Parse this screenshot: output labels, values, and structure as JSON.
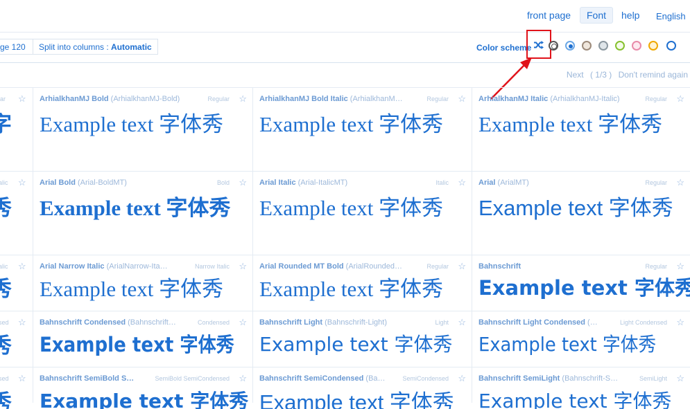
{
  "nav": {
    "front_page": "front page",
    "font": "Font",
    "help": "help",
    "language": "English"
  },
  "toolbar": {
    "page_fragment": "ge 120",
    "split_label": "Split into columns : ",
    "split_value": "Automatic",
    "color_scheme_label": "Color scheme",
    "shuffle_icon": "shuffle-icon",
    "swatches": [
      {
        "ring": "#555555",
        "dot": "#ffffff",
        "bg": "#ffffff"
      },
      {
        "ring": "#6aa7e6",
        "dot": "#1e6fd0",
        "bg": "#ffffff"
      },
      {
        "ring": "#9c8a7a",
        "dot": "#efe6dc",
        "bg": "#efe6dc"
      },
      {
        "ring": "#8b979f",
        "dot": "#dfe5e9",
        "bg": "#dfe5e9"
      },
      {
        "ring": "#86c12e",
        "dot": "#f4fbe9",
        "bg": "#f4fbe9"
      },
      {
        "ring": "#e88aa9",
        "dot": "#fde9f0",
        "bg": "#fde9f0"
      },
      {
        "ring": "#f0a800",
        "dot": "#fff3d2",
        "bg": "#fff3d2"
      },
      {
        "ring": "#1e6fd0",
        "dot": "#1e6fd0",
        "bg": "#ffffff"
      }
    ]
  },
  "pager": {
    "next": "Next",
    "count": "( 1/3 )",
    "dont_remind": "Don't remind again"
  },
  "left_fragments": [
    {
      "tag": "lar",
      "glyph": "字"
    },
    {
      "tag": "alic",
      "glyph": "秀"
    },
    {
      "tag": "alic",
      "glyph": "秀"
    },
    {
      "tag": "sed",
      "glyph": "秀"
    },
    {
      "tag": "sed",
      "glyph": "秀"
    }
  ],
  "sample_text": "Example text 字体秀",
  "rows": [
    [
      {
        "name": "ArhialkhanMJ Bold",
        "ps": " (ArhialkhanMJ-Bold)",
        "tag": "Regular",
        "style": "serif"
      },
      {
        "name": "ArhialkhanMJ Bold Italic",
        "ps": " (ArhialkhanM…",
        "tag": "Regular",
        "style": "serif"
      },
      {
        "name": "ArhialkhanMJ Italic",
        "ps": " (ArhialkhanMJ-Italic)",
        "tag": "Regular",
        "style": "serif"
      }
    ],
    [
      {
        "name": "Arial Bold",
        "ps": " (Arial-BoldMT)",
        "tag": "Bold",
        "style": "serif-bold"
      },
      {
        "name": "Arial Italic",
        "ps": " (Arial-ItalicMT)",
        "tag": "Italic",
        "style": "serif"
      },
      {
        "name": "Arial",
        "ps": " (ArialMT)",
        "tag": "Regular",
        "style": "sans"
      }
    ],
    [
      {
        "name": "Arial Narrow Italic",
        "ps": " (ArialNarrow-Ita…",
        "tag": "Narrow Italic",
        "style": "serif"
      },
      {
        "name": "Arial Rounded MT Bold",
        "ps": " (ArialRounded…",
        "tag": "Regular",
        "style": "serif"
      },
      {
        "name": "Bahnschrift",
        "ps": "",
        "tag": "Regular",
        "style": "sans-semibold"
      }
    ],
    [
      {
        "name": "Bahnschrift Condensed",
        "ps": " (Bahnschrift…",
        "tag": "Condensed",
        "style": "sans-cond"
      },
      {
        "name": "Bahnschrift Light",
        "ps": " (Bahnschrift-Light)",
        "tag": "Light",
        "style": "sans-light"
      },
      {
        "name": "Bahnschrift Light Condensed",
        "ps": " (…",
        "tag": "Light Condensed",
        "style": "sans-light-cond"
      }
    ],
    [
      {
        "name": "Bahnschrift SemiBold S…",
        "ps": "",
        "tag": "SemiBold SemiCondensed",
        "style": "sans-bold"
      },
      {
        "name": "Bahnschrift SemiCondensed",
        "ps": " (Ba…",
        "tag": "SemiCondensed",
        "style": "sans"
      },
      {
        "name": "Bahnschrift SemiLight",
        "ps": " (Bahnschrift-S…",
        "tag": "SemiLight",
        "style": "sans-light"
      }
    ]
  ]
}
